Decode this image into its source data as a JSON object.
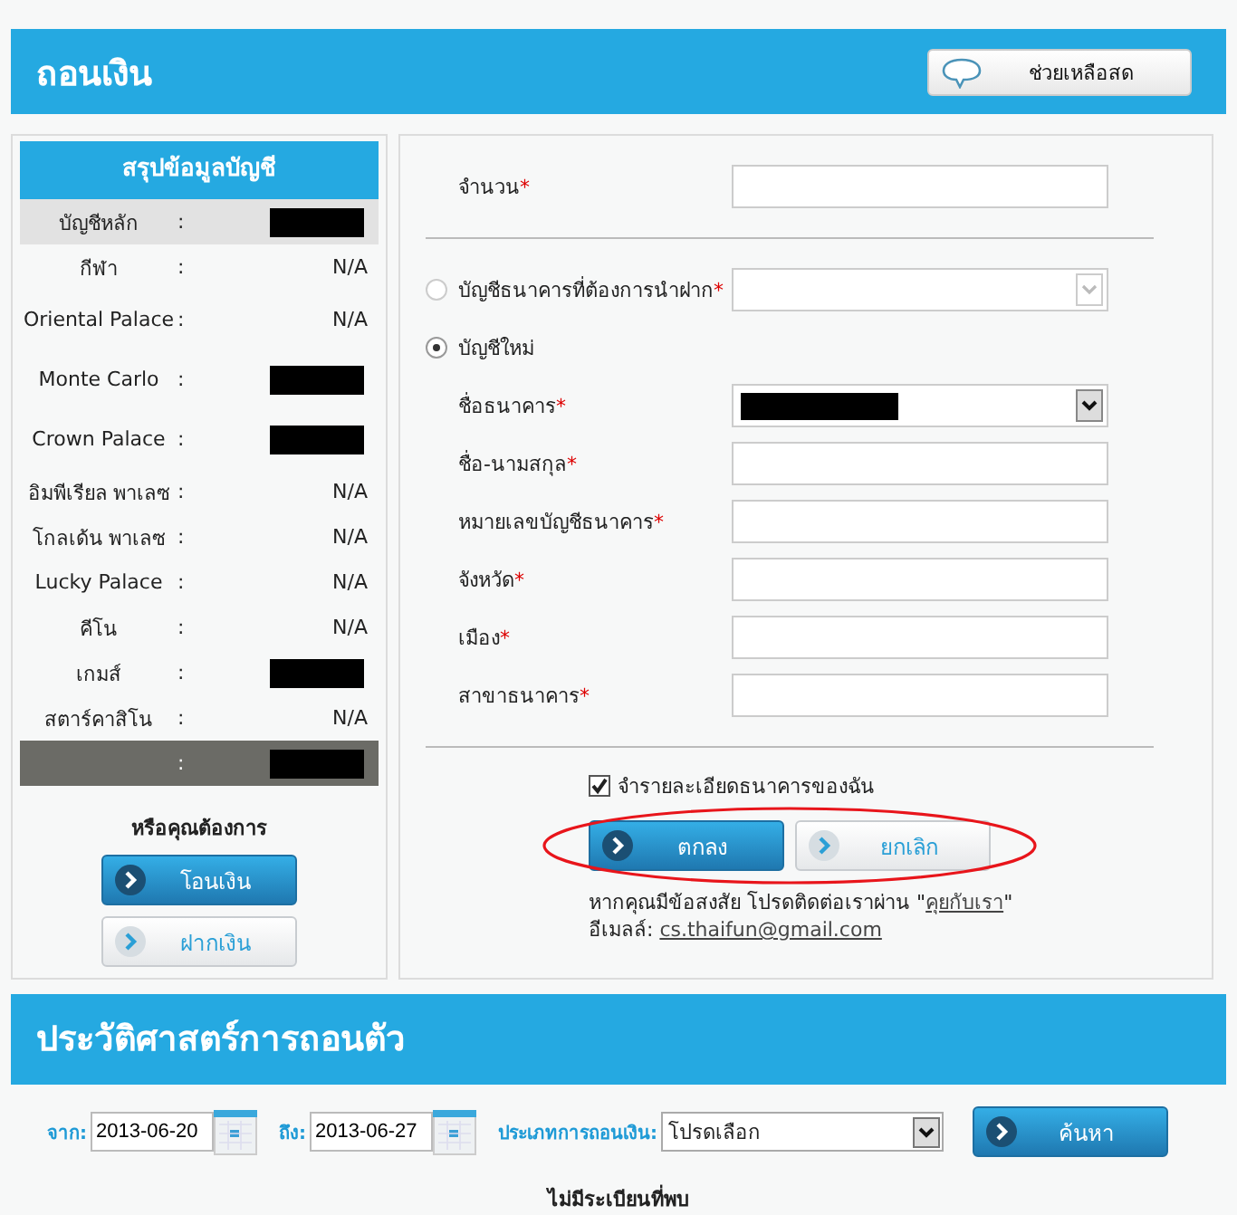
{
  "page_title": "ถอนเงิน",
  "help_button": "ช่วยเหลือสด",
  "summary": {
    "title": "สรุปข้อมูลบัญชี",
    "rows": [
      {
        "label": "บัญชีหลัก",
        "separator": ":",
        "kind": "redacted",
        "highlighted": true
      },
      {
        "label": "กีฬา",
        "separator": ":",
        "kind": "text",
        "value": "N/A",
        "highlighted": false
      },
      {
        "label": "Oriental Palace",
        "separator": ":",
        "kind": "text",
        "value": "N/A",
        "highlighted": false
      },
      {
        "label": "Monte Carlo",
        "separator": ":",
        "kind": "redacted",
        "highlighted": false
      },
      {
        "label": "Crown Palace",
        "separator": ":",
        "kind": "redacted",
        "highlighted": false
      },
      {
        "label": "อิมพีเรียล พาเลซ",
        "separator": ":",
        "kind": "text",
        "value": "N/A",
        "highlighted": false
      },
      {
        "label": "โกลเด้น พาเลซ",
        "separator": ":",
        "kind": "text",
        "value": "N/A",
        "highlighted": false
      },
      {
        "label": "Lucky Palace",
        "separator": ":",
        "kind": "text",
        "value": "N/A",
        "highlighted": false
      },
      {
        "label": "คีโน",
        "separator": ":",
        "kind": "text",
        "value": "N/A",
        "highlighted": false
      },
      {
        "label": "เกมส์",
        "separator": ":",
        "kind": "redacted",
        "highlighted": false
      },
      {
        "label": "สตาร์คาสิโน",
        "separator": ":",
        "kind": "text",
        "value": "N/A",
        "highlighted": false
      }
    ],
    "total_row": {
      "separator": ":",
      "kind": "redacted"
    },
    "prompt": "หรือคุณต้องการ",
    "buttons": [
      {
        "label": "โอนเงิน",
        "kind": "primary"
      },
      {
        "label": "ฝากเงิน",
        "kind": "secondary"
      }
    ]
  },
  "form": {
    "amount": {
      "label": "จำนวน",
      "required_mark": "*"
    },
    "account_choices": [
      {
        "label": "บัญชีธนาคารที่ต้องการนำฝาก",
        "required_mark": "*",
        "selected": false,
        "kind": "select",
        "disabled": true
      },
      {
        "label": "บัญชีใหม่",
        "selected": true,
        "kind": "none"
      }
    ],
    "fields": [
      {
        "label": "ชื่อธนาคาร",
        "required_mark": "*",
        "kind": "select",
        "disabled": false,
        "redacted": true
      },
      {
        "label": "ชื่อ-นามสกุล",
        "required_mark": "*",
        "kind": "text"
      },
      {
        "label": "หมายเลขบัญชีธนาคาร",
        "required_mark": "*",
        "kind": "text"
      },
      {
        "label": "จังหวัด",
        "required_mark": "*",
        "kind": "text"
      },
      {
        "label": "เมือง",
        "required_mark": "*",
        "kind": "text"
      },
      {
        "label": "สาขาธนาคาร",
        "required_mark": "*",
        "kind": "text"
      }
    ],
    "remember": {
      "label": "จำรายละเอียดธนาคารของฉัน",
      "checked": true
    },
    "actions": [
      {
        "label": "ตกลง",
        "kind": "primary"
      },
      {
        "label": "ยกเลิก",
        "kind": "secondary"
      }
    ],
    "contact_text": "หากคุณมีข้อสงสัย โปรดติดต่อเราผ่าน \"",
    "contact_link": "คุยกับเรา",
    "contact_suffix": "\"",
    "email_label": "อีเมลล์:",
    "email": "cs.thaifun@gmail.com"
  },
  "history": {
    "title": "ประวัติศาสตร์การถอนตัว",
    "from_label": "จาก:",
    "from_value": "2013-06-20",
    "to_label": "ถึง:",
    "to_value": "2013-06-27",
    "type_label": "ประเภทการถอนเงิน:",
    "type_value": "โปรดเลือก",
    "search_button": "ค้นหา",
    "empty_message": "ไม่มีระเบียนที่พบ"
  }
}
